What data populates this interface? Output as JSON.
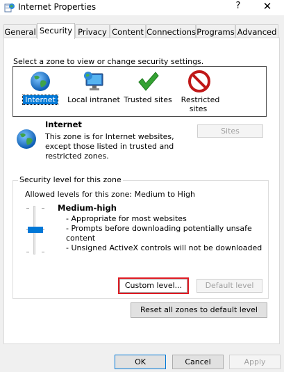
{
  "window": {
    "title": "Internet Properties",
    "help": "?",
    "close": "✕"
  },
  "tabs": [
    "General",
    "Security",
    "Privacy",
    "Content",
    "Connections",
    "Programs",
    "Advanced"
  ],
  "active_tab": "Security",
  "security": {
    "zone_prompt": "Select a zone to view or change security settings.",
    "zones": [
      {
        "label": "Internet",
        "icon": "globe-icon",
        "selected": true
      },
      {
        "label": "Local intranet",
        "icon": "intranet-monitor-icon"
      },
      {
        "label": "Trusted sites",
        "icon": "green-checkmark-icon"
      },
      {
        "label": "Restricted sites",
        "icon": "restricted-no-entry-icon"
      }
    ],
    "zone_info": {
      "title": "Internet",
      "line1": "This zone is for Internet websites,",
      "line2": "except those listed in trusted and",
      "line3": "restricted zones."
    },
    "sites_button": "Sites",
    "group_title": "Security level for this zone",
    "allowed_levels": "Allowed levels for this zone: Medium to High",
    "level_name": "Medium-high",
    "level_bullets": [
      "- Appropriate for most websites",
      "- Prompts before downloading potentially unsafe",
      "content",
      "- Unsigned ActiveX controls will not be downloaded"
    ],
    "custom_level_button": "Custom level...",
    "default_level_button": "Default level",
    "reset_button": "Reset all zones to default level"
  },
  "footer": {
    "ok": "OK",
    "cancel": "Cancel",
    "apply": "Apply"
  },
  "colors": {
    "selection": "#0078d7",
    "highlight_outline": "#e01b24",
    "disabled_text": "#a0a0a0"
  }
}
